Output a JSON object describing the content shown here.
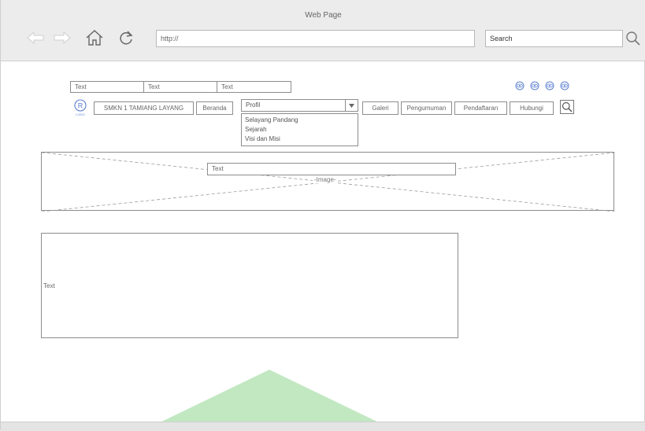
{
  "window": {
    "title": "Web Page"
  },
  "browser": {
    "url": "http://",
    "search_value": "Search",
    "icons": {
      "back": "arrow-left-icon",
      "forward": "arrow-right-icon",
      "home": "home-icon",
      "reload": "reload-icon",
      "search": "search-icon"
    }
  },
  "top_texts": [
    "Text",
    "Text",
    "Text"
  ],
  "social_icons": [
    "social-icon",
    "social-icon",
    "social-icon",
    "social-icon"
  ],
  "logo": {
    "glyph": "R",
    "caption": "LOGO"
  },
  "nav": {
    "school": "SMKN 1 TAMIANG LAYANG",
    "home": "Beranda",
    "profile": {
      "selected": "Profil",
      "options": [
        "Selayang Pandang",
        "Sejarah",
        "Visi dan Misi"
      ]
    },
    "gallery": "Galeri",
    "announcement": "Pengumuman",
    "registration": "Pendaftaran",
    "contact": "Hubungi"
  },
  "banner": {
    "text": "Text",
    "image_label": "Image"
  },
  "content": {
    "text": "Text"
  },
  "colors": {
    "chrome": "#ececec",
    "accent": "#5b7fd1",
    "border": "#8d8d8d",
    "watermark": "#8fd68f"
  }
}
